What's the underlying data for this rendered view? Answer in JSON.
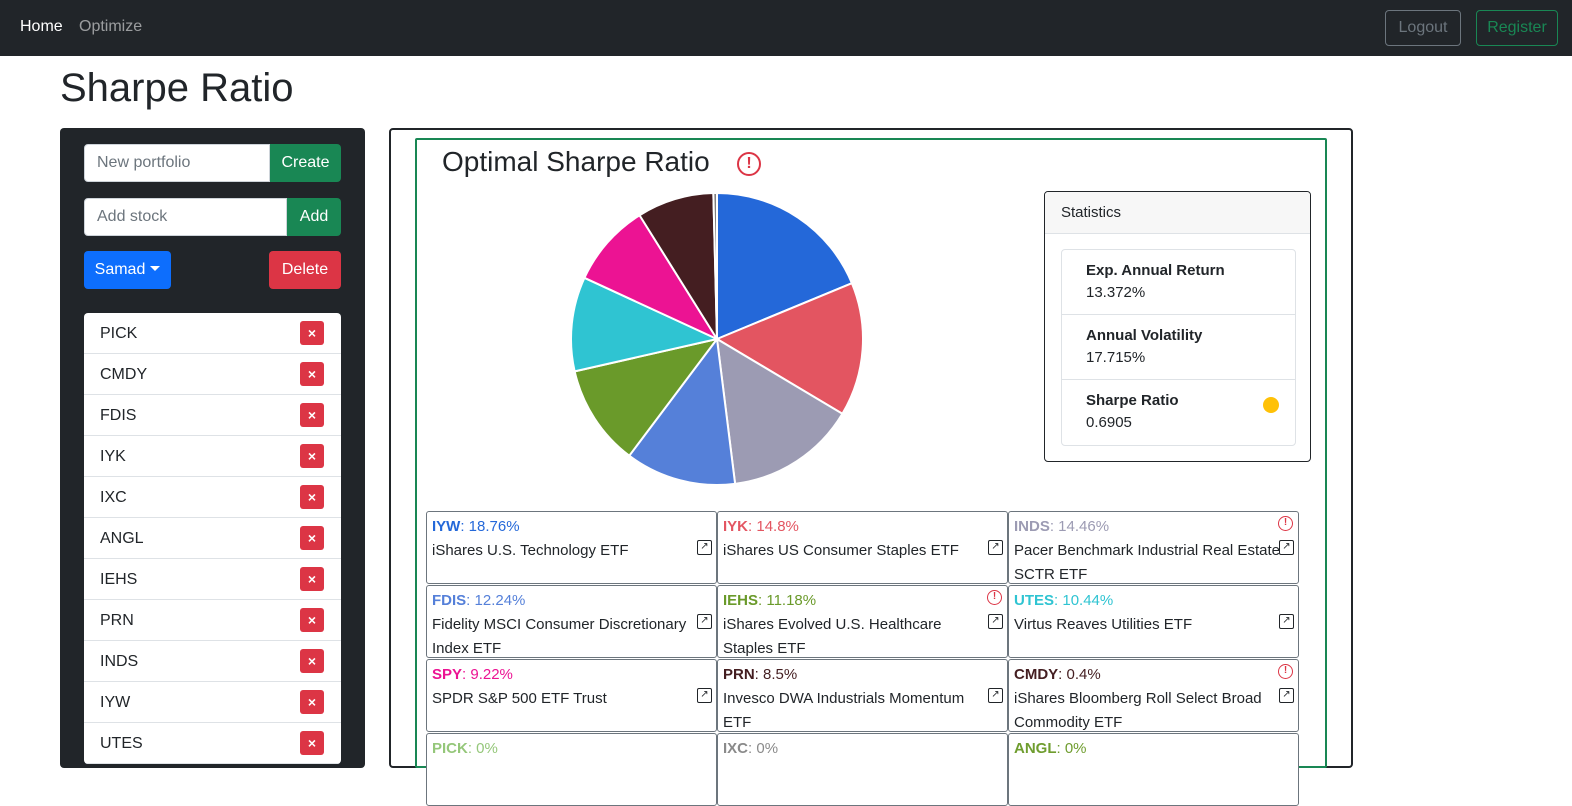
{
  "nav": {
    "home": "Home",
    "optimize": "Optimize",
    "logout": "Logout",
    "register": "Register"
  },
  "page_title": "Sharpe Ratio",
  "sidebar": {
    "portfolio_placeholder": "New portfolio",
    "create_label": "Create",
    "stock_placeholder": "Add stock",
    "add_label": "Add",
    "portfolio_select": "Samad",
    "delete_label": "Delete",
    "remove_symbol": "×",
    "stocks": [
      "PICK",
      "CMDY",
      "FDIS",
      "IYK",
      "IXC",
      "ANGL",
      "IEHS",
      "PRN",
      "INDS",
      "IYW",
      "UTES"
    ]
  },
  "chart": {
    "title": "Optimal Sharpe Ratio",
    "warn_symbol": "!"
  },
  "chart_data": {
    "type": "pie",
    "labels": [
      "IYW",
      "IYK",
      "INDS",
      "FDIS",
      "IEHS",
      "UTES",
      "SPY",
      "PRN",
      "CMDY",
      "PICK",
      "IXC",
      "ANGL"
    ],
    "values": [
      18.76,
      14.8,
      14.46,
      12.24,
      11.18,
      10.44,
      9.22,
      8.5,
      0.4,
      0,
      0,
      0
    ],
    "colors": [
      "#2468d9",
      "#e35561",
      "#9c9bb3",
      "#5580d9",
      "#6a9a2a",
      "#2fc4d2",
      "#ec1393",
      "#441e21",
      "#7f7f7f",
      "#95c77a",
      "#999999",
      "#6f9d2f"
    ]
  },
  "statistics": {
    "header": "Statistics",
    "items": [
      {
        "label": "Exp. Annual Return",
        "value": "13.372%"
      },
      {
        "label": "Annual Volatility",
        "value": "17.715%"
      },
      {
        "label": "Sharpe Ratio",
        "value": "0.6905"
      }
    ],
    "sharpe_indicator_color": "#ffc107"
  },
  "etfs": [
    {
      "ticker": "IYW",
      "weight": ": 18.76%",
      "name": "iShares U.S. Technology ETF",
      "color": "#2468d9",
      "warn": false
    },
    {
      "ticker": "IYK",
      "weight": ": 14.8%",
      "name": "iShares US Consumer Staples ETF",
      "color": "#e35561",
      "warn": false
    },
    {
      "ticker": "INDS",
      "weight": ": 14.46%",
      "name": "Pacer Benchmark Industrial Real Estate SCTR ETF",
      "color": "#9c9bb3",
      "warn": true
    },
    {
      "ticker": "FDIS",
      "weight": ": 12.24%",
      "name": "Fidelity MSCI Consumer Discretionary Index ETF",
      "color": "#5580d9",
      "warn": false
    },
    {
      "ticker": "IEHS",
      "weight": ": 11.18%",
      "name": "iShares Evolved U.S. Healthcare Staples ETF",
      "color": "#6a9a2a",
      "warn": true
    },
    {
      "ticker": "UTES",
      "weight": ": 10.44%",
      "name": "Virtus Reaves Utilities ETF",
      "color": "#2fc4d2",
      "warn": false
    },
    {
      "ticker": "SPY",
      "weight": ": 9.22%",
      "name": "SPDR S&P 500 ETF Trust",
      "color": "#ec1393",
      "warn": false
    },
    {
      "ticker": "PRN",
      "weight": ": 8.5%",
      "name": "Invesco DWA Industrials Momentum ETF",
      "color": "#441e21",
      "warn": false
    },
    {
      "ticker": "CMDY",
      "weight": ": 0.4%",
      "name": "iShares Bloomberg Roll Select Broad Commodity ETF",
      "color": "#441e21",
      "warn": true
    },
    {
      "ticker": "PICK",
      "weight": ": 0%",
      "name": "",
      "color": "#95c77a",
      "warn": false
    },
    {
      "ticker": "IXC",
      "weight": ": 0%",
      "name": "",
      "color": "#8a8a8a",
      "warn": false
    },
    {
      "ticker": "ANGL",
      "weight": ": 0%",
      "name": "",
      "color": "#6f9d2f",
      "warn": false
    }
  ],
  "ext_link_symbol": "↗"
}
